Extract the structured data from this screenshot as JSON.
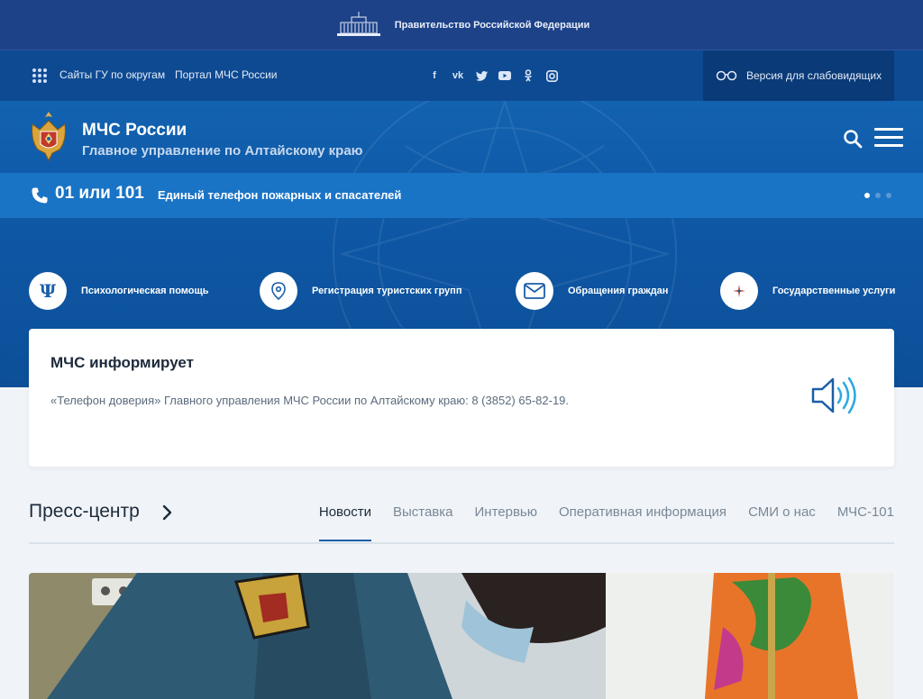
{
  "gov_bar": {
    "label": "Правительство Российской Федерации"
  },
  "top_nav": {
    "links": [
      "Сайты ГУ по округам",
      "Портал МЧС России"
    ],
    "social_icons": [
      "facebook-icon",
      "vk-icon",
      "twitter-icon",
      "youtube-icon",
      "odnoklassniki-icon",
      "instagram-icon"
    ],
    "vision_label": "Версия для слабовидящих"
  },
  "header": {
    "title": "МЧС России",
    "subtitle": "Главное управление по Алтайскому краю"
  },
  "phone_bar": {
    "number": "01 или 101",
    "description": "Единый телефон пожарных и спасателей",
    "slides": 3,
    "active_slide": 1
  },
  "quick_links": [
    {
      "label": "Психологическая помощь",
      "icon": "psi-icon"
    },
    {
      "label": "Регистрация туристских групп",
      "icon": "location-pin-icon"
    },
    {
      "label": "Обращения граждан",
      "icon": "envelope-icon"
    },
    {
      "label": "Государственные услуги",
      "icon": "services-icon"
    }
  ],
  "info_card": {
    "heading": "МЧС информирует",
    "message": "«Телефон доверия» Главного управления МЧС России по Алтайскому краю: 8 (3852) 65-82-19."
  },
  "press": {
    "title": "Пресс-центр",
    "tabs": [
      "Новости",
      "Выставка",
      "Интервью",
      "Оперативная информация",
      "СМИ о нас",
      "МЧС-101"
    ],
    "active_tab": "Новости"
  },
  "colors": {
    "gov_bar": "#1d4288",
    "top_nav": "#0e4a92",
    "header": "#1262b0",
    "phone_bar": "#1a74c6",
    "page_bg": "#f0f4f8"
  }
}
